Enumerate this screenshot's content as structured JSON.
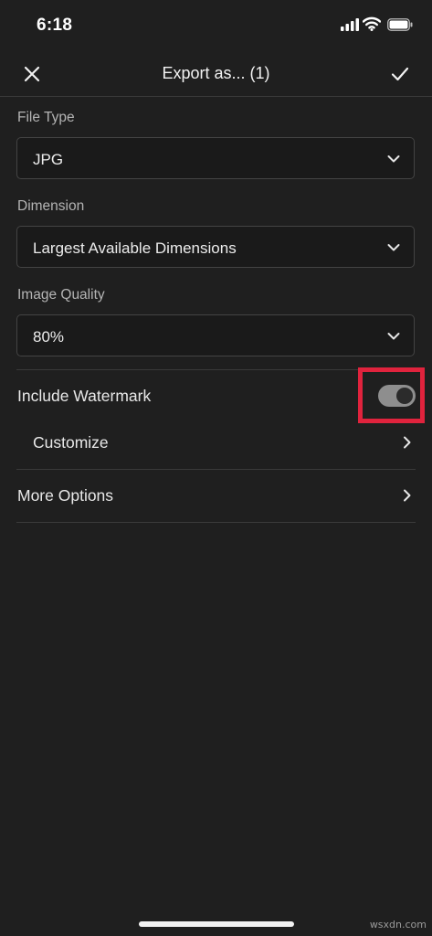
{
  "status_bar": {
    "time": "6:18"
  },
  "nav": {
    "title": "Export as... (1)"
  },
  "file_type": {
    "label": "File Type",
    "value": "JPG"
  },
  "dimension": {
    "label": "Dimension",
    "value": "Largest Available Dimensions"
  },
  "image_quality": {
    "label": "Image Quality",
    "value": "80%"
  },
  "watermark_toggle": {
    "label": "Include Watermark",
    "enabled": true
  },
  "customize": {
    "label": "Customize"
  },
  "more_options": {
    "label": "More Options"
  },
  "site_watermark": "wsxdn.com",
  "colors": {
    "highlight": "#e0233d",
    "background": "#1f1f1f",
    "toggle_on": "#8e8e8e"
  }
}
